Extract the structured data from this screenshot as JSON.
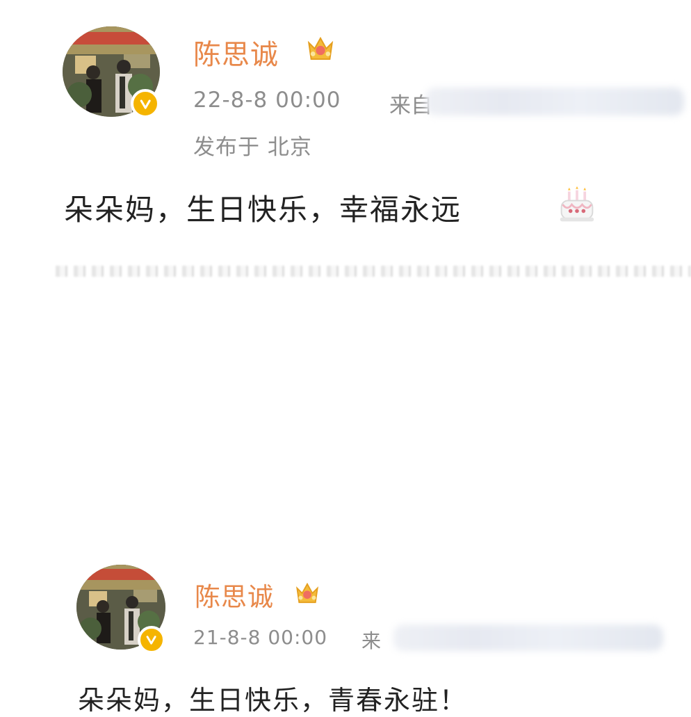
{
  "posts": [
    {
      "username": "陈思诚",
      "time": "22-8-8 00:00",
      "source_prefix": "来自",
      "location": "发布于 北京",
      "content": "朵朵妈，生日快乐，幸福永远",
      "emoji": "birthday-cake-icon"
    },
    {
      "username": "陈思诚",
      "time": "21-8-8 00:00",
      "source_prefix": "来",
      "content": "朵朵妈，生日快乐，青春永驻！"
    }
  ],
  "colors": {
    "username": "#e8884a",
    "meta": "#8d8d8d",
    "content": "#222222",
    "verified_badge": "#f5b400"
  }
}
